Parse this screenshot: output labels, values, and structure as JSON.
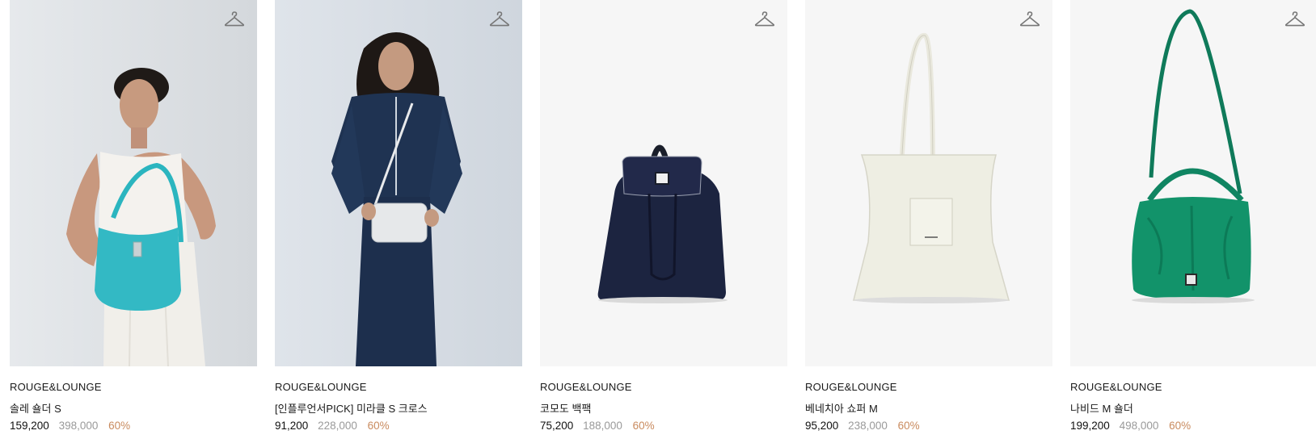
{
  "products": [
    {
      "brand": "ROUGE&LOUNGE",
      "name": "솔레 숄더 S",
      "price": "159,200",
      "original_price": "398,000",
      "discount": "60%",
      "image": "model-with-turquoise-shoulder-bag"
    },
    {
      "brand": "ROUGE&LOUNGE",
      "name": "[인플루언서PICK] 미라클 S 크로스",
      "price": "91,200",
      "original_price": "228,000",
      "discount": "60%",
      "image": "model-with-light-gray-crossbody-bag"
    },
    {
      "brand": "ROUGE&LOUNGE",
      "name": "코모도 백팩",
      "price": "75,200",
      "original_price": "188,000",
      "discount": "60%",
      "image": "navy-drawstring-backpack"
    },
    {
      "brand": "ROUGE&LOUNGE",
      "name": "베네치아 쇼퍼 M",
      "price": "95,200",
      "original_price": "238,000",
      "discount": "60%",
      "image": "ivory-tote-shopper-bag"
    },
    {
      "brand": "ROUGE&LOUNGE",
      "name": "나비드 M 숄더",
      "price": "199,200",
      "original_price": "498,000",
      "discount": "60%",
      "image": "green-crinkled-shoulder-bag"
    }
  ],
  "icons": {
    "wishlist": "hanger-icon"
  },
  "colors": {
    "price": "#111111",
    "original_price": "#9a9a9a",
    "discount": "#c98b5f",
    "image_background": "#f6f6f6"
  }
}
